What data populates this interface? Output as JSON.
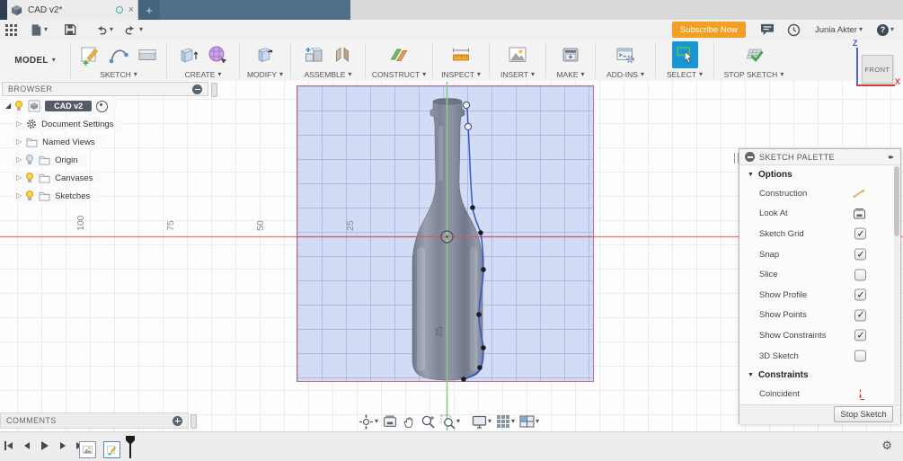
{
  "window": {
    "tab_title": "CAD v2*",
    "close_label": "×",
    "new_tab_label": "+"
  },
  "appbar": {
    "subscribe_label": "Subscribe Now",
    "user_name": "Junia Akter",
    "help_label": "?"
  },
  "ribbon": {
    "workspace_label": "MODEL",
    "groups": [
      {
        "label": "SKETCH"
      },
      {
        "label": "CREATE"
      },
      {
        "label": "MODIFY"
      },
      {
        "label": "ASSEMBLE"
      },
      {
        "label": "CONSTRUCT"
      },
      {
        "label": "INSPECT"
      },
      {
        "label": "INSERT"
      },
      {
        "label": "MAKE"
      },
      {
        "label": "ADD-INS"
      },
      {
        "label": "SELECT"
      },
      {
        "label": "STOP SKETCH"
      }
    ]
  },
  "browser": {
    "title": "BROWSER",
    "root_label": "CAD v2",
    "items": [
      {
        "label": "Document Settings"
      },
      {
        "label": "Named Views"
      },
      {
        "label": "Origin"
      },
      {
        "label": "Canvases"
      },
      {
        "label": "Sketches"
      }
    ]
  },
  "viewcube": {
    "face_label": "FRONT",
    "x_label": "X",
    "z_label": "Z"
  },
  "canvas": {
    "ruler_labels": [
      "100",
      "75",
      "50",
      "25"
    ],
    "vertical_axis_label": "25"
  },
  "palette": {
    "title": "SKETCH PALETTE",
    "options_header": "Options",
    "options": [
      {
        "label": "Construction",
        "control": "construction-icon",
        "checked": false
      },
      {
        "label": "Look At",
        "control": "look-at-icon",
        "checked": false
      },
      {
        "label": "Sketch Grid",
        "control": "checkbox",
        "checked": true
      },
      {
        "label": "Snap",
        "control": "checkbox",
        "checked": true
      },
      {
        "label": "Slice",
        "control": "checkbox",
        "checked": false
      },
      {
        "label": "Show Profile",
        "control": "checkbox",
        "checked": true
      },
      {
        "label": "Show Points",
        "control": "checkbox",
        "checked": true
      },
      {
        "label": "Show Constraints",
        "control": "checkbox",
        "checked": true
      },
      {
        "label": "3D Sketch",
        "control": "checkbox",
        "checked": false
      }
    ],
    "constraints_header": "Constraints",
    "constraints": [
      {
        "label": "Coincident"
      }
    ],
    "stop_sketch_label": "Stop Sketch"
  },
  "comments": {
    "title": "COMMENTS"
  }
}
